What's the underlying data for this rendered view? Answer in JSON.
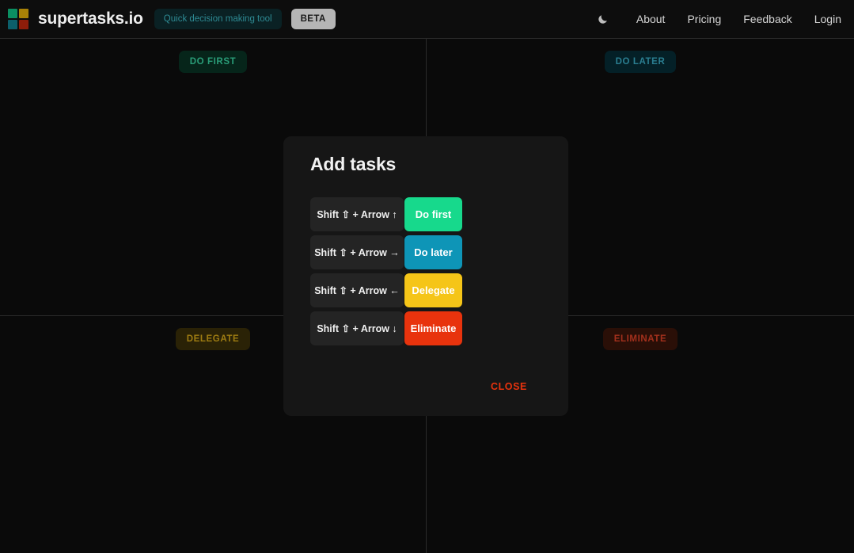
{
  "header": {
    "brand": "supertasks.io",
    "tagline": "Quick decision making tool",
    "beta_label": "BETA",
    "logo_colors": {
      "top_left": "#0b8f62",
      "top_right": "#a98207",
      "bottom_left": "#0c5f6b",
      "bottom_right": "#8e1d0a"
    },
    "theme_toggle_icon": "moon-icon",
    "nav": [
      {
        "label": "About"
      },
      {
        "label": "Pricing"
      },
      {
        "label": "Feedback"
      },
      {
        "label": "Login"
      }
    ]
  },
  "board": {
    "quadrants": [
      {
        "key": "do-first",
        "label": "DO FIRST",
        "text_color": "#2a9d78",
        "bg_color": "#06251a"
      },
      {
        "key": "do-later",
        "label": "DO LATER",
        "text_color": "#2b7f92",
        "bg_color": "#042027"
      },
      {
        "key": "delegate",
        "label": "DELEGATE",
        "text_color": "#9e7c12",
        "bg_color": "#2a2206"
      },
      {
        "key": "eliminate",
        "label": "ELIMINATE",
        "text_color": "#a3301c",
        "bg_color": "#2a0f07"
      }
    ]
  },
  "modal": {
    "title": "Add tasks",
    "shortcuts": [
      {
        "keys": "Shift ⇧ + Arrow ↑",
        "action": "Do first",
        "color": "#17d98c"
      },
      {
        "keys": "Shift ⇧ + Arrow →",
        "action": "Do later",
        "color": "#0e95b7"
      },
      {
        "keys": "Shift ⇧ + Arrow ←",
        "action": "Delegate",
        "color": "#f5c518"
      },
      {
        "keys": "Shift ⇧ + Arrow ↓",
        "action": "Eliminate",
        "color": "#e8330d"
      }
    ],
    "close_label": "CLOSE",
    "close_color": "#e8330d"
  }
}
